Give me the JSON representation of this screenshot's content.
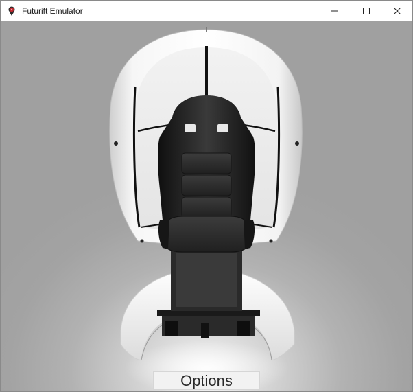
{
  "window": {
    "title": "Futurift Emulator",
    "app_icon": "red-pin-icon",
    "controls": {
      "minimize_icon": "minimize-icon",
      "maximize_icon": "maximize-icon",
      "close_icon": "close-icon"
    }
  },
  "viewport": {
    "scene_subject": "futurift-seat-model",
    "options_label": "Options"
  },
  "colors": {
    "accent": "#c0262d",
    "background_light": "#f4f4f4",
    "background_dark": "#a0a0a0",
    "shell": "#ffffff",
    "seat": "#1c1c1c"
  }
}
